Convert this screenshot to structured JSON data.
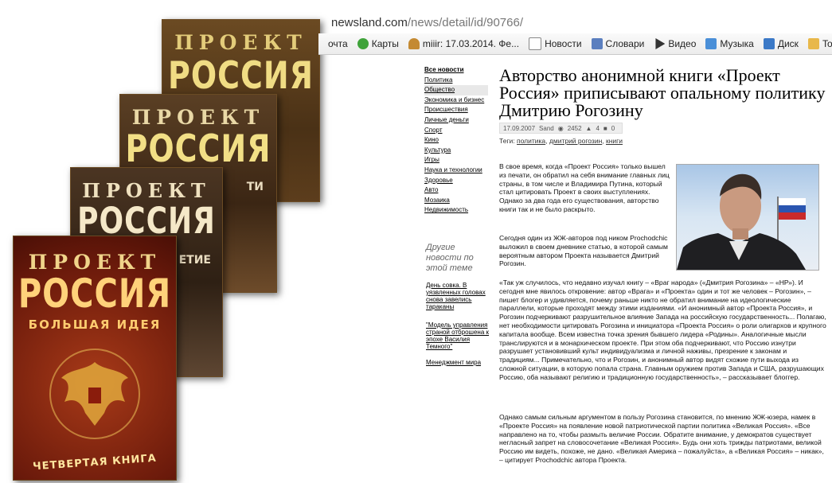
{
  "covers": [
    {
      "line1": "ПРОЕКТ",
      "line2": "РОССИЯ"
    },
    {
      "line1": "ПРОЕКТ",
      "line2": "РОССИЯ",
      "spine": "ТИ"
    },
    {
      "line1": "ПРОЕКТ",
      "line2": "РОССИЯ",
      "spine": "ЕТИЕ"
    },
    {
      "line1": "ПРОЕКТ",
      "line2": "РОССИЯ",
      "line3": "БОЛЬШАЯ ИДЕЯ",
      "line4": "ЧЕТВЕРТАЯ КНИГА"
    }
  ],
  "browser": {
    "url_host": "newsland.com",
    "url_path": "/news/detail/id/90766/",
    "bookmarks": [
      "очта",
      "Карты",
      "miiir: 17.03.2014. Фе...",
      "Новости",
      "Словари",
      "Видео",
      "Музыка",
      "Диск",
      "Toshib"
    ]
  },
  "sidebar": {
    "items": [
      "Все новости",
      "Политика",
      "Общество",
      "Экономика и бизнес",
      "Происшествия",
      "Личные деньги",
      "Спорт",
      "Кино",
      "Культура",
      "Игры",
      "Наука и технологии",
      "Здоровье",
      "Авто",
      "Мозаика",
      "Недвижимость"
    ],
    "other_title": "Другие новости по этой теме",
    "other_links": [
      "День совка. В уязвленных головах снова завелись тараканы",
      "\"Модель управления страной отброшена к эпохе Василия Темного\"",
      "Менеджмент мира"
    ]
  },
  "article": {
    "title": "Авторство анонимной книги «Проект Россия» приписывают опальному политику Дмитрию Рогозину",
    "date": "17.09.2007",
    "author": "Sand",
    "views": "2452",
    "likes": "4",
    "comments": "0",
    "tags_label": "Теги:",
    "tags": [
      "политика",
      "дмитрий рогозин",
      "книги"
    ],
    "paragraphs": [
      "В свое время, когда «Проект Россия» только вышел из печати, он обратил на себя внимание главных лиц страны, в том числе и Владимира Путина, который стал цитировать Проект в своих выступлениях. Однако за два года его существования, авторство книги так и не было раскрыто.",
      "Сегодня один из ЖЖ-авторов под ником Prochodchic выложил в своем дневнике статью, в которой самым вероятным автором Проекта называется Дмитрий Рогозин.",
      "«Так уж случилось, что недавно изучал книгу – «Враг народа» («Дмитрия Рогозина» – «НР»). И сегодня мне явилось откровение: автор «Врага» и «Проекта» один и тот же человек – Рогозин», – пишет блогер и удивляется, почему раньше никто не обратил внимание на идеологические параллели, которые проходят между этими изданиями. «И анонимный автор «Проекта Россия», и Рогозин подчеркивают разрушительное влияние Запада на российскую государственность... Полагаю, нет необходимости цитировать Рогозина и инициатора «Проекта Россия» о роли олигархов и крупного капитала вообще. Всем известна точка зрения бывшего лидера «Родины». Аналогичные мысли транслируются и в монархическом проекте. При этом оба подчеркивают, что Россию изнутри разрушает установивший культ индивидуализма и личной наживы, презрение к законам и традициям... Примечательно, что и Рогозин, и анонимный автор видят схожие пути выхода из сложной ситуации, в которую попала страна. Главным оружием против Запада и США, разрушающих Россию, оба называют религию и традиционную государственность», – рассказывает блоггер.",
      "Однако самым сильным аргументом в пользу Рогозина становится, по мнению ЖЖ-юзера, намек в «Проекте Россия» на появление новой патриотической партии политика «Великая Россия». «Все направлено на то, чтобы размыть величие России. Обратите внимание, у демократов существует негласный запрет на словосочетание «Великая Россия». Будь они хоть трижды патриотами, великой Россию им видеть, похоже, не дано. «Великая Америка – пожалуйста», а «Великая Россия» – никак», – цитирует Prochodchic автора Проекта."
    ]
  },
  "colors": {
    "cover_gold": "#f0dc84",
    "cover_red": "#a83a18",
    "link": "#000000"
  }
}
